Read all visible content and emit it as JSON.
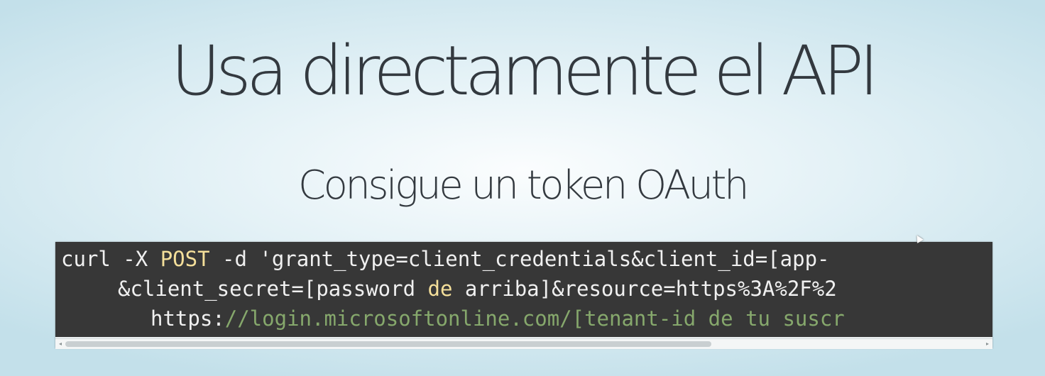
{
  "slide": {
    "title": "Usa directamente el API",
    "subtitle": "Consigue un token OAuth"
  },
  "code": {
    "line1": {
      "p1": "curl -X ",
      "p2": "POST",
      "p3": " -d 'grant_type=client_credentials&client_id=[app-"
    },
    "line2": {
      "p1": "&client_secret=[password ",
      "p2": "de",
      "p3": " arriba]&resource=https%3A%2F%2"
    },
    "line3": {
      "p1": "https:",
      "p2": "//login.microsoftonline.com/[tenant-id de tu suscr"
    }
  },
  "scrollbar": {
    "left_arrow": "◂",
    "right_arrow": "▸"
  },
  "colors": {
    "code_background": "#373737",
    "keyword": "#f4df9a",
    "url": "#86a86c",
    "text": "#f0f0f0"
  }
}
